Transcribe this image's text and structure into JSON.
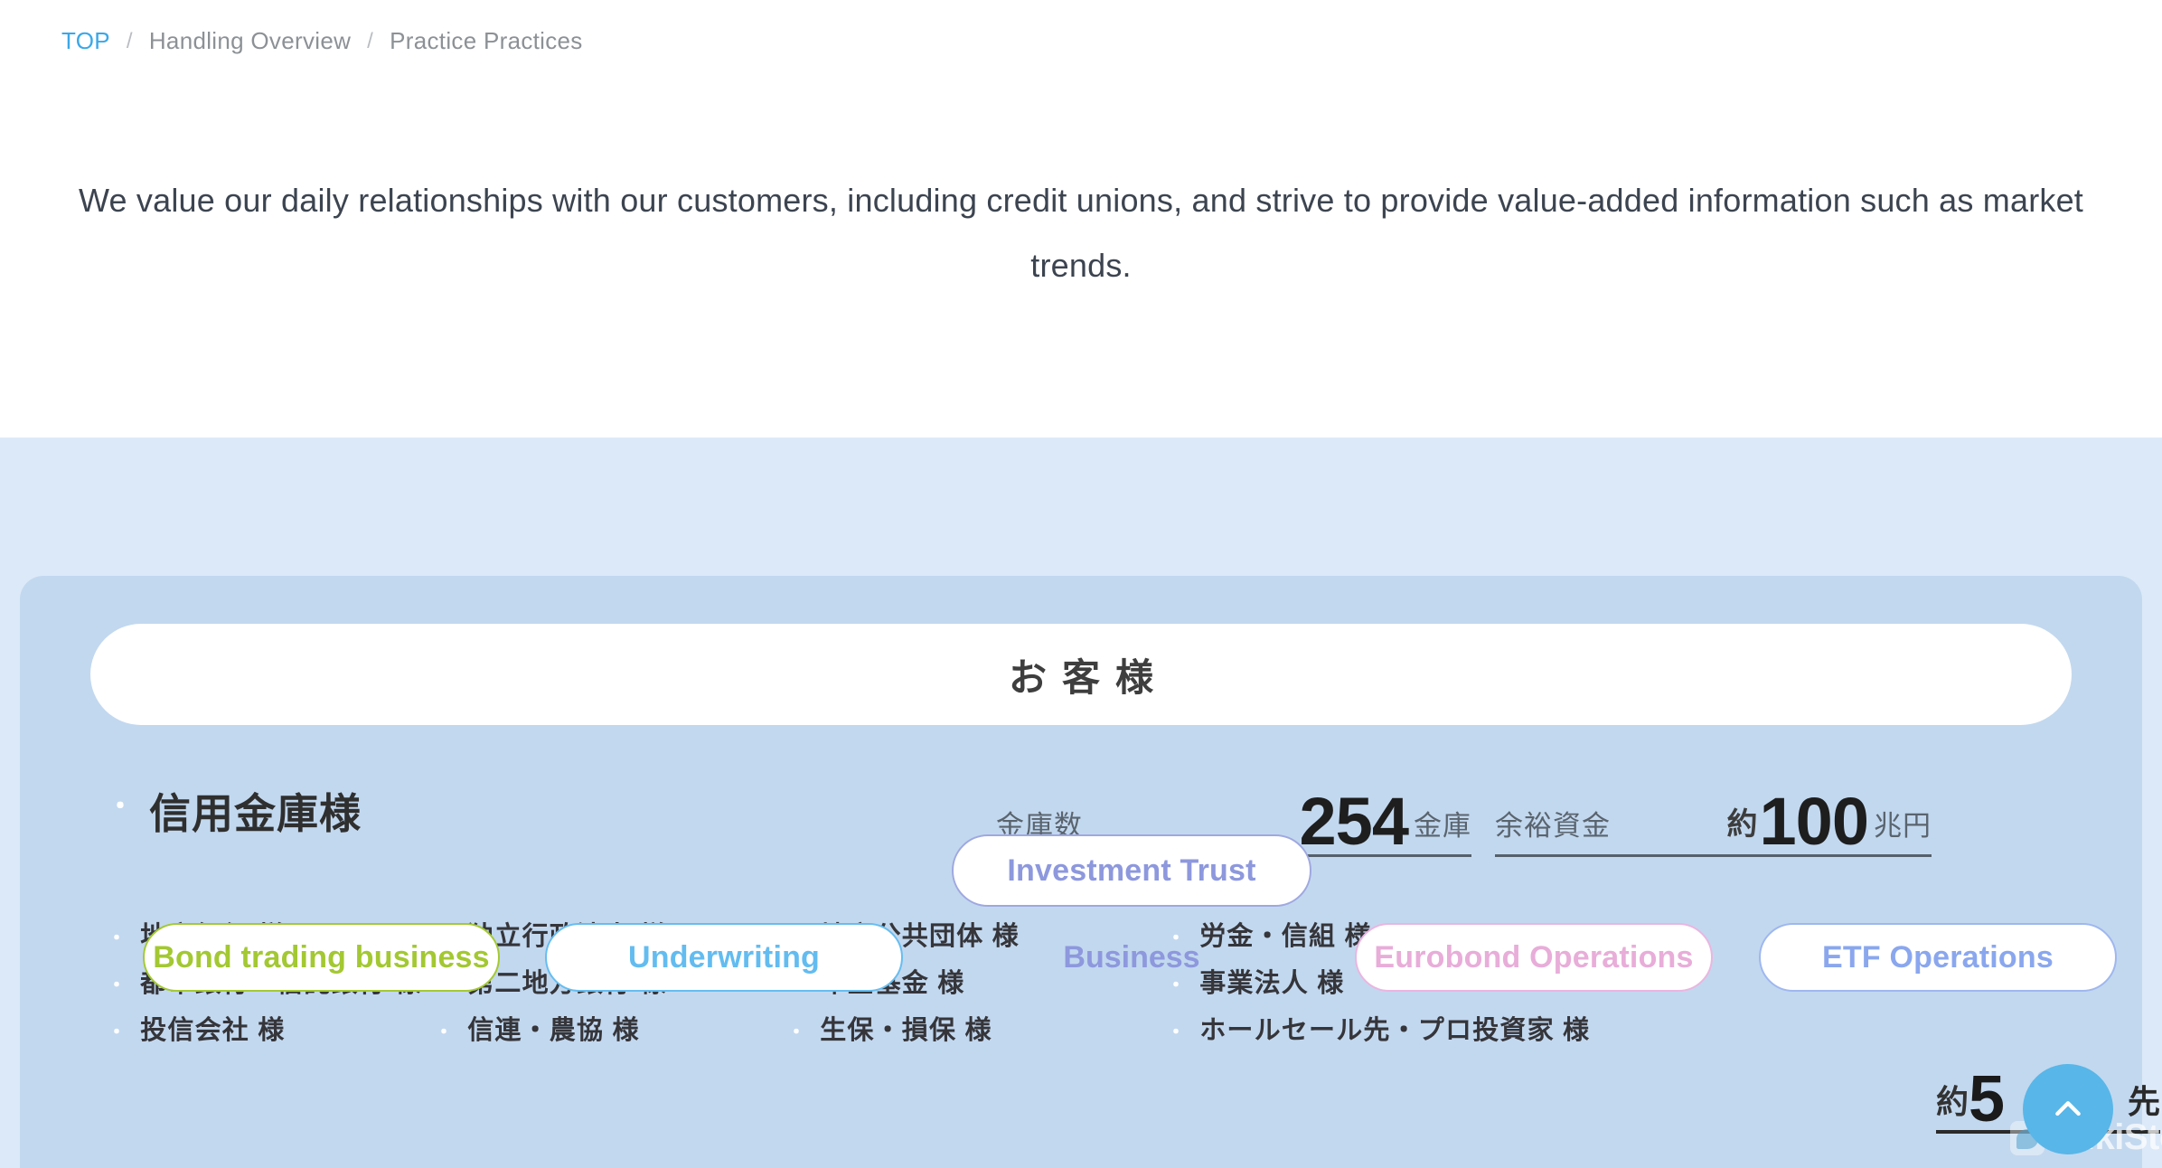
{
  "breadcrumb": {
    "items": [
      {
        "label": "TOP",
        "type": "link"
      },
      {
        "label": "Handling Overview",
        "type": "link"
      },
      {
        "label": "Practice Practices",
        "type": "current"
      }
    ],
    "separator": "/"
  },
  "lead": {
    "text": "We value our daily relationships with our customers, including credit unions, and strive to provide value-added information such as market trends."
  },
  "tabs": [
    {
      "label": "Investment Trust",
      "style": "pill",
      "color": "#8d98dd",
      "border": "#9fa8e0"
    },
    {
      "label": "Bond trading business",
      "style": "pill",
      "color": "#a3c832",
      "border": "#a4c932"
    },
    {
      "label": "Underwriting",
      "style": "pill",
      "color": "#63bcf0",
      "border": "#66bdf0"
    },
    {
      "label": "Business",
      "style": "plain",
      "color": "#8d98dd",
      "border": "none"
    },
    {
      "label": "Eurobond Operations",
      "style": "pill",
      "color": "#e8add9",
      "border": "#eab5e0"
    },
    {
      "label": "ETF Operations",
      "style": "pill",
      "color": "#8aa7ee",
      "border": "#9fb7ef"
    }
  ],
  "customer_banner": {
    "title": "お客様"
  },
  "primary": {
    "name": "信用金庫様",
    "bullet": "・",
    "stats": [
      {
        "label": "金庫数",
        "approx": "",
        "value": "254",
        "unit": "金庫"
      },
      {
        "label": "余裕資金",
        "approx": "約",
        "value": "100",
        "unit": "兆円"
      }
    ]
  },
  "client_columns": [
    {
      "items": [
        "地方銀行 様",
        "都市銀行・信託銀行 様",
        "投信会社 様"
      ]
    },
    {
      "items": [
        "独立行政法人 様",
        "第二地方銀行 様",
        "信連・農協 様"
      ]
    },
    {
      "items": [
        "地方公共団体 様",
        "年金基金 様",
        "生保・損保 様"
      ]
    },
    {
      "items": [
        "労金・信組 様",
        "事業法人 様",
        "ホールセール先・プロ投資家 様"
      ]
    }
  ],
  "bottom_stat": {
    "approx": "約",
    "value": "5",
    "unit": "先"
  },
  "watermark": {
    "text": "WikiStock"
  },
  "scroll_top": {
    "aria_label": "Scroll to top"
  },
  "colors": {
    "band_outer": "#dce9f8",
    "panel": "#c2d8ef",
    "banner": "#ffffff",
    "accent_link": "#3aa8e8",
    "scroll_button": "#58b6e8"
  }
}
